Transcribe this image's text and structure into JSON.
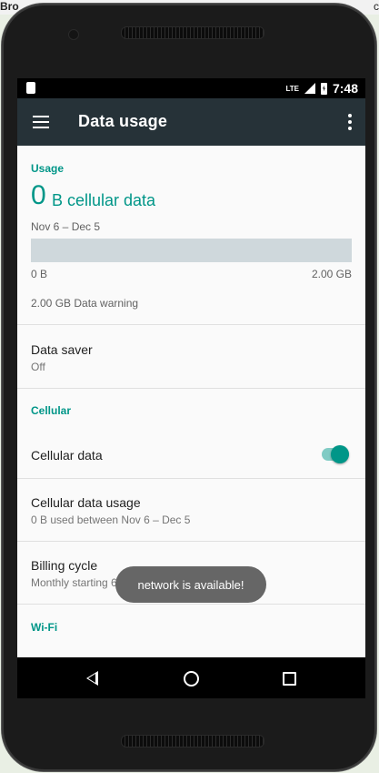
{
  "background": {
    "left_text": "Bro",
    "right_text": "c"
  },
  "status_bar": {
    "network": "LTE",
    "time": "7:48"
  },
  "app_bar": {
    "title": "Data usage",
    "menu_icon": "hamburger-menu-icon",
    "overflow_icon": "more-vert-icon"
  },
  "usage": {
    "section_label": "Usage",
    "amount_number": "0",
    "amount_unit": "B cellular data",
    "date_range": "Nov 6 – Dec 5",
    "bar_min_label": "0 B",
    "bar_max_label": "2.00 GB",
    "bar_fill_fraction": 0,
    "warning": "2.00 GB Data warning"
  },
  "data_saver": {
    "title": "Data saver",
    "status": "Off"
  },
  "cellular": {
    "section_label": "Cellular",
    "cellular_data_label": "Cellular data",
    "cellular_data_enabled": true,
    "usage_title": "Cellular data usage",
    "usage_sub": "0 B used between Nov 6 – Dec 5",
    "billing_title": "Billing cycle",
    "billing_sub": "Monthly starting 6"
  },
  "wifi": {
    "section_label": "Wi-Fi"
  },
  "toast": {
    "message": "network is available!"
  },
  "colors": {
    "accent": "#009688",
    "app_bar": "#263238",
    "usage_bar": "#cfd8dc"
  }
}
